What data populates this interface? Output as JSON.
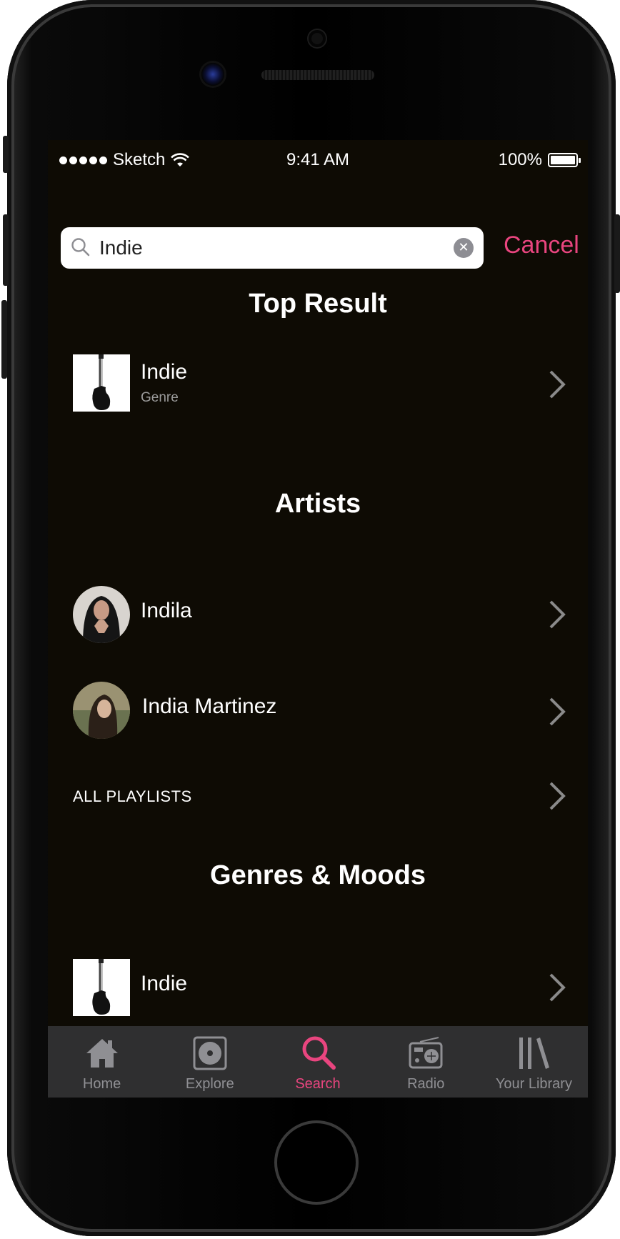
{
  "status_bar": {
    "carrier": "Sketch",
    "time": "9:41 AM",
    "battery": "100%"
  },
  "search": {
    "value": "Indie",
    "cancel_label": "Cancel"
  },
  "sections": {
    "top_result_title": "Top Result",
    "artists_title": "Artists",
    "genres_title": "Genres & Moods"
  },
  "top_result": {
    "title": "Indie",
    "subtitle": "Genre"
  },
  "artists": [
    {
      "name": "Indila"
    },
    {
      "name": "India Martinez"
    }
  ],
  "all_playlists_label": "ALL PLAYLISTS",
  "genres": [
    {
      "name": "Indie"
    }
  ],
  "tabbar": {
    "tabs": [
      {
        "label": "Home",
        "icon": "home-icon"
      },
      {
        "label": "Explore",
        "icon": "explore-icon"
      },
      {
        "label": "Search",
        "icon": "search-icon"
      },
      {
        "label": "Radio",
        "icon": "radio-icon"
      },
      {
        "label": "Your Library",
        "icon": "library-icon"
      }
    ],
    "active": "Search"
  },
  "colors": {
    "accent": "#e9457f",
    "background": "#0e0b04",
    "tabbar": "#2f2f30",
    "inactive": "#8f8f93"
  }
}
